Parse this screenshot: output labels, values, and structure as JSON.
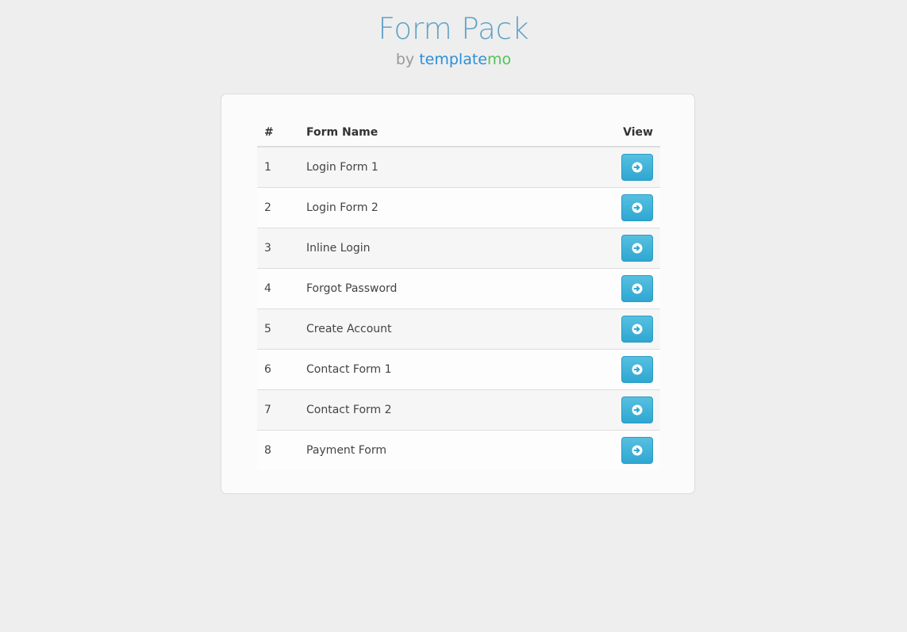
{
  "header": {
    "title": "Form Pack",
    "by_label": "by",
    "brand_part1": "template",
    "brand_part2": "mo"
  },
  "table": {
    "columns": [
      "#",
      "Form Name",
      "View"
    ],
    "rows": [
      {
        "num": "1",
        "name": "Login Form 1"
      },
      {
        "num": "2",
        "name": "Login Form 2"
      },
      {
        "num": "3",
        "name": "Inline Login"
      },
      {
        "num": "4",
        "name": "Forgot Password"
      },
      {
        "num": "5",
        "name": "Create Account"
      },
      {
        "num": "6",
        "name": "Contact Form 1"
      },
      {
        "num": "7",
        "name": "Contact Form 2"
      },
      {
        "num": "8",
        "name": "Payment Form"
      }
    ],
    "view_icon": "arrow-circle-right-icon"
  },
  "colors": {
    "title": "#5fa3c4",
    "brand_part1": "#2a8fd8",
    "brand_part2": "#52c25a",
    "button": "#2ea7d2"
  }
}
